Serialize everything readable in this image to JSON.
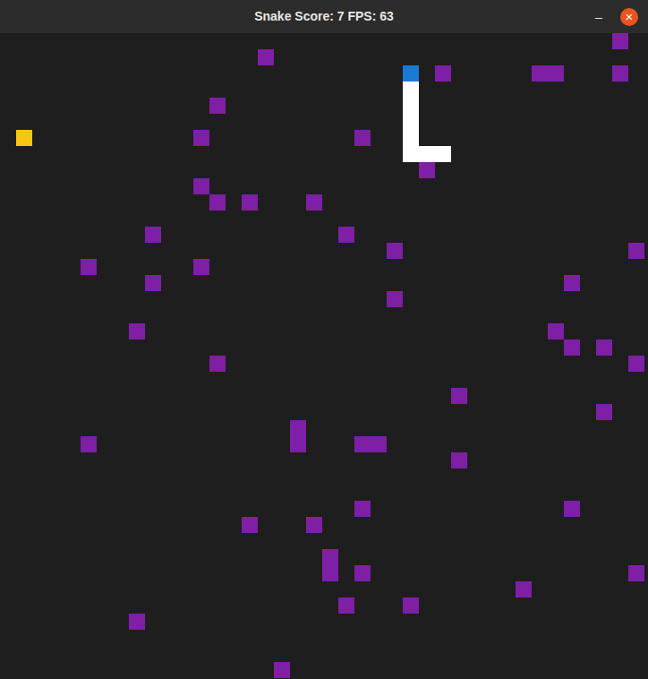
{
  "window": {
    "title": "Snake Score: 7 FPS: 63",
    "minimize": "–",
    "close": "×"
  },
  "board": {
    "cols": 40,
    "rows": 40
  },
  "snake": [
    {
      "col": 25,
      "row": 2,
      "kind": "head",
      "color": "#1a7ad4"
    },
    {
      "col": 25,
      "row": 3,
      "kind": "body",
      "color": "#ffffff"
    },
    {
      "col": 25,
      "row": 4,
      "kind": "body",
      "color": "#ffffff"
    },
    {
      "col": 25,
      "row": 5,
      "kind": "body",
      "color": "#ffffff"
    },
    {
      "col": 25,
      "row": 6,
      "kind": "body",
      "color": "#ffffff"
    },
    {
      "col": 25,
      "row": 7,
      "kind": "body",
      "color": "#ffffff"
    },
    {
      "col": 26,
      "row": 7,
      "kind": "body",
      "color": "#ffffff"
    },
    {
      "col": 27,
      "row": 7,
      "kind": "body",
      "color": "#ffffff"
    }
  ],
  "food": {
    "col": 1,
    "row": 6,
    "color": "#f7c513"
  },
  "obstacles": {
    "color": "#7e1fa6",
    "cells": [
      [
        38,
        0
      ],
      [
        16,
        1
      ],
      [
        27,
        2
      ],
      [
        33,
        2
      ],
      [
        34,
        2
      ],
      [
        38,
        2
      ],
      [
        13,
        4
      ],
      [
        12,
        6
      ],
      [
        22,
        6
      ],
      [
        26,
        8
      ],
      [
        12,
        9
      ],
      [
        13,
        10
      ],
      [
        15,
        10
      ],
      [
        19,
        10
      ],
      [
        9,
        12
      ],
      [
        21,
        12
      ],
      [
        24,
        13
      ],
      [
        39,
        13
      ],
      [
        5,
        14
      ],
      [
        12,
        14
      ],
      [
        9,
        15
      ],
      [
        35,
        15
      ],
      [
        24,
        16
      ],
      [
        8,
        18
      ],
      [
        34,
        18
      ],
      [
        35,
        19
      ],
      [
        37,
        19
      ],
      [
        13,
        20
      ],
      [
        39,
        20
      ],
      [
        28,
        22
      ],
      [
        37,
        23
      ],
      [
        18,
        24
      ],
      [
        18,
        25
      ],
      [
        5,
        25
      ],
      [
        22,
        25
      ],
      [
        23,
        25
      ],
      [
        28,
        26
      ],
      [
        22,
        29
      ],
      [
        35,
        29
      ],
      [
        15,
        30
      ],
      [
        19,
        30
      ],
      [
        20,
        32
      ],
      [
        20,
        33
      ],
      [
        22,
        33
      ],
      [
        39,
        33
      ],
      [
        32,
        34
      ],
      [
        21,
        35
      ],
      [
        25,
        35
      ],
      [
        8,
        36
      ],
      [
        17,
        39
      ]
    ]
  }
}
